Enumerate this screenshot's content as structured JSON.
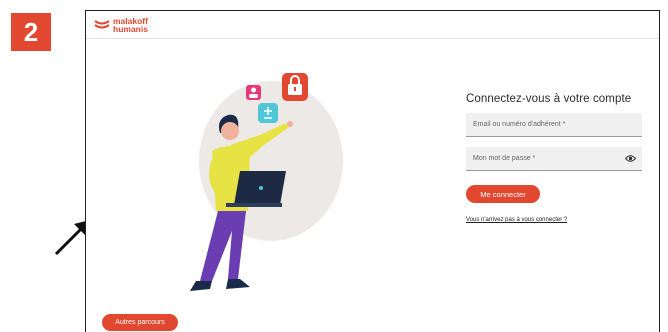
{
  "step": {
    "number": "2"
  },
  "brand": {
    "line1": "malakoff",
    "line2": "humanis",
    "color": "#e2472f"
  },
  "login": {
    "title": "Connectez-vous à votre compte",
    "email_placeholder": "Email ou numéro d'adhérent *",
    "password_placeholder": "Mon mot de passe *",
    "submit_label": "Me connecter",
    "help_link": "Vous n'arrivez pas à vous connecter ?"
  },
  "footer": {
    "other_paths_label": "Autres parcours"
  },
  "icons": {
    "pointer": "arrow-pointer-icon",
    "password_visibility": "eye-icon",
    "floating": [
      "user-card-icon",
      "plus-minus-icon",
      "lock-icon"
    ]
  }
}
